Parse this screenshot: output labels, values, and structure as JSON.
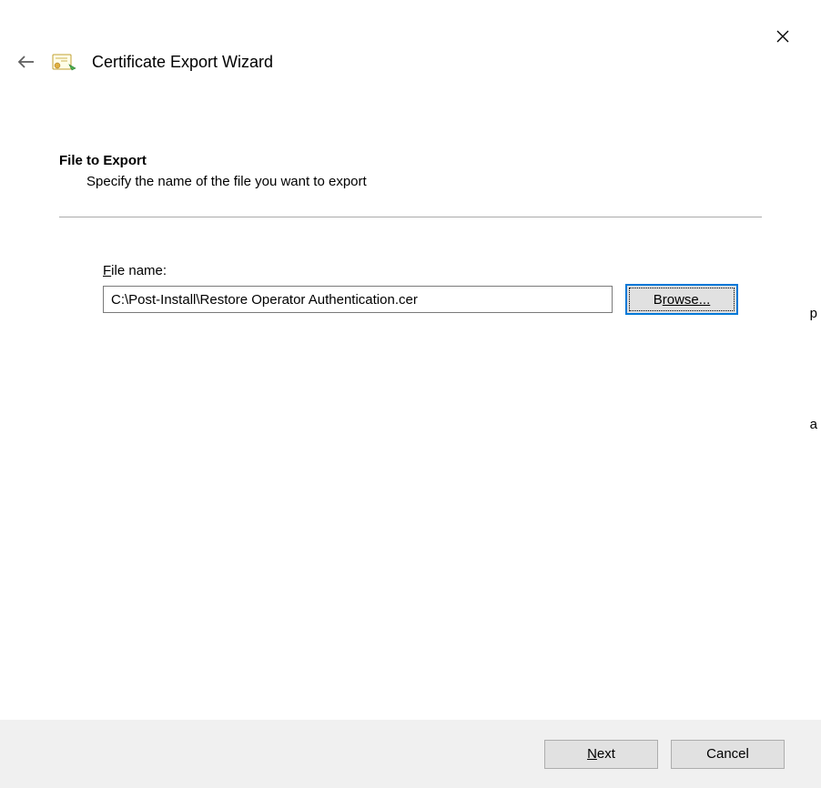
{
  "wizard": {
    "title": "Certificate Export Wizard"
  },
  "section": {
    "heading": "File to Export",
    "description": "Specify the name of the file you want to export"
  },
  "file": {
    "label_prefix": "F",
    "label_rest": "ile name:",
    "value": "C:\\Post-Install\\Restore Operator Authentication.cer"
  },
  "buttons": {
    "browse_prefix": "B",
    "browse_rest": "rowse...",
    "next_prefix": "N",
    "next_rest": "ext",
    "cancel": "Cancel"
  },
  "stray": {
    "a": "p",
    "b": "a"
  }
}
